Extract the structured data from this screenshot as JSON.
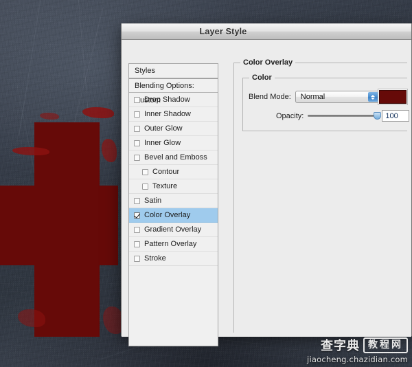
{
  "window": {
    "title": "Layer Style"
  },
  "styles_panel": {
    "header_label": "Styles",
    "blending_options_label": "Blending Options: Custom",
    "items": [
      {
        "label": "Drop Shadow",
        "checked": false,
        "indent": false,
        "selected": false
      },
      {
        "label": "Inner Shadow",
        "checked": false,
        "indent": false,
        "selected": false
      },
      {
        "label": "Outer Glow",
        "checked": false,
        "indent": false,
        "selected": false
      },
      {
        "label": "Inner Glow",
        "checked": false,
        "indent": false,
        "selected": false
      },
      {
        "label": "Bevel and Emboss",
        "checked": false,
        "indent": false,
        "selected": false
      },
      {
        "label": "Contour",
        "checked": false,
        "indent": true,
        "selected": false
      },
      {
        "label": "Texture",
        "checked": false,
        "indent": true,
        "selected": false
      },
      {
        "label": "Satin",
        "checked": false,
        "indent": false,
        "selected": false
      },
      {
        "label": "Color Overlay",
        "checked": true,
        "indent": false,
        "selected": true
      },
      {
        "label": "Gradient Overlay",
        "checked": false,
        "indent": false,
        "selected": false
      },
      {
        "label": "Pattern Overlay",
        "checked": false,
        "indent": false,
        "selected": false
      },
      {
        "label": "Stroke",
        "checked": false,
        "indent": false,
        "selected": false
      }
    ]
  },
  "color_overlay": {
    "group_title": "Color Overlay",
    "color_group_title": "Color",
    "blend_mode": {
      "label": "Blend Mode:",
      "value": "Normal"
    },
    "swatch": {
      "color": "#660a08",
      "name": "color-swatch"
    },
    "opacity": {
      "label": "Opacity:",
      "value": "100",
      "unit": "%",
      "percent": 100
    }
  },
  "canvas": {
    "cross_color": "#660a08",
    "background_color": "#3d4450"
  },
  "watermark": {
    "brand_cn": "查字典",
    "brand_box": "教程网",
    "url": "jiaocheng.chazidian.com"
  }
}
